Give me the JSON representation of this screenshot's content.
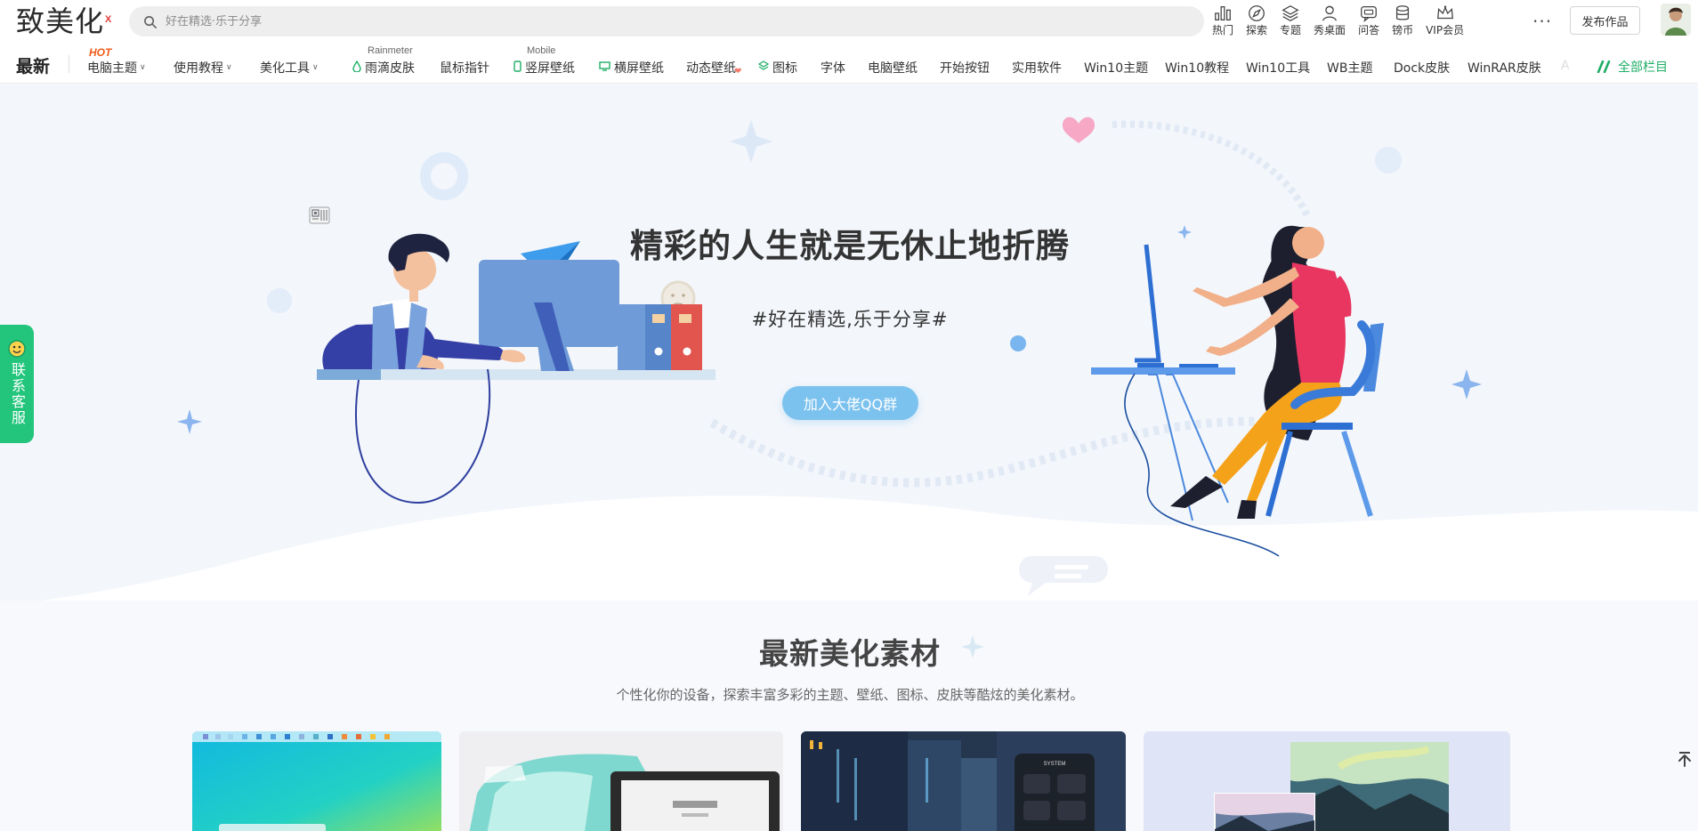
{
  "header": {
    "logo_text": "致美化",
    "logo_mark": "X",
    "search": {
      "placeholder": "好在精选·乐于分享"
    },
    "links": [
      {
        "label": "热门",
        "icon": "trending-icon"
      },
      {
        "label": "探索",
        "icon": "compass-icon"
      },
      {
        "label": "专题",
        "icon": "layers-icon"
      },
      {
        "label": "秀桌面",
        "icon": "person-icon"
      },
      {
        "label": "问答",
        "icon": "qa-icon"
      },
      {
        "label": "镑币",
        "icon": "coin-icon"
      },
      {
        "label": "VIP会员",
        "icon": "crown-icon"
      }
    ],
    "more": "···",
    "publish_label": "发布作品"
  },
  "nav": {
    "latest": "最新",
    "hot_badge": "HOT",
    "items": [
      {
        "label": "电脑主题",
        "dropdown": true
      },
      {
        "label": "使用教程",
        "dropdown": true
      },
      {
        "label": "美化工具",
        "dropdown": true
      },
      {
        "label": "雨滴皮肤",
        "sub": "Rainmeter"
      },
      {
        "label": "鼠标指针"
      },
      {
        "label": "竖屏壁纸",
        "sub": "Mobile"
      },
      {
        "label": "横屏壁纸"
      },
      {
        "label": "动态壁纸"
      },
      {
        "label": "图标"
      },
      {
        "label": "字体"
      },
      {
        "label": "电脑壁纸"
      },
      {
        "label": "开始按钮"
      },
      {
        "label": "实用软件"
      },
      {
        "label": "Win10主题"
      },
      {
        "label": "Win10教程"
      },
      {
        "label": "Win10工具"
      },
      {
        "label": "WB主题"
      },
      {
        "label": "Dock皮肤"
      },
      {
        "label": "WinRAR皮肤"
      },
      {
        "label": "A"
      }
    ],
    "all_label": "全部栏目"
  },
  "hero": {
    "title": "精彩的人生就是无休止地折腾",
    "subtitle": "#好在精选,乐于分享#",
    "button_label": "加入大佬QQ群"
  },
  "side_service": {
    "label": "联系客服"
  },
  "section": {
    "title": "最新美化素材",
    "description": "个性化你的设备，探索丰富多彩的主题、壁纸、图标、皮肤等酷炫的美化素材。"
  },
  "colors": {
    "accent_green": "#22c57b",
    "hero_button": "#7cc2ef",
    "hot_orange": "#f05a1a"
  }
}
